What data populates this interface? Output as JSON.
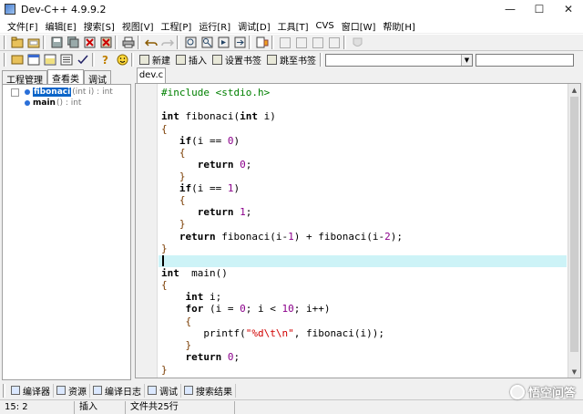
{
  "window": {
    "title": "Dev-C++ 4.9.9.2",
    "minimize": "—",
    "maximize": "☐",
    "close": "✕"
  },
  "menu": [
    "文件[F]",
    "编辑[E]",
    "搜索[S]",
    "视图[V]",
    "工程[P]",
    "运行[R]",
    "调试[D]",
    "工具[T]",
    "CVS",
    "窗口[W]",
    "帮助[H]"
  ],
  "toolbar2": {
    "new_label": "新建",
    "insert_label": "插入",
    "set_bookmark_label": "设置书签",
    "goto_bookmark_label": "跳至书签",
    "combo1_value": "",
    "combo2_value": ""
  },
  "left_tabs": [
    "工程管理",
    "查看类",
    "调试"
  ],
  "class_tree": [
    {
      "name": "fibonaci",
      "sig": "(int i) : int",
      "selected": true
    },
    {
      "name": "main",
      "sig": "() : int",
      "selected": false
    }
  ],
  "editor_tab": "dev.c",
  "code": [
    "#include <stdio.h>",
    "",
    "int fibonaci(int i)",
    "{",
    "   if(i == 0)",
    "   {",
    "      return 0;",
    "   }",
    "   if(i == 1)",
    "   {",
    "      return 1;",
    "   }",
    "   return fibonaci(i-1) + fibonaci(i-2);",
    "}",
    "",
    "int  main()",
    "{",
    "    int i;",
    "    for (i = 0; i < 10; i++)",
    "    {",
    "       printf(\"%d\\t\\n\", fibonaci(i));",
    "    }",
    "    return 0;",
    "}"
  ],
  "bottom_tabs": [
    "编译器",
    "资源",
    "编译日志",
    "调试",
    "搜索结果"
  ],
  "status": {
    "position": "15: 2",
    "mode": "插入",
    "lines": "文件共25行"
  },
  "watermark": "悟空问答"
}
